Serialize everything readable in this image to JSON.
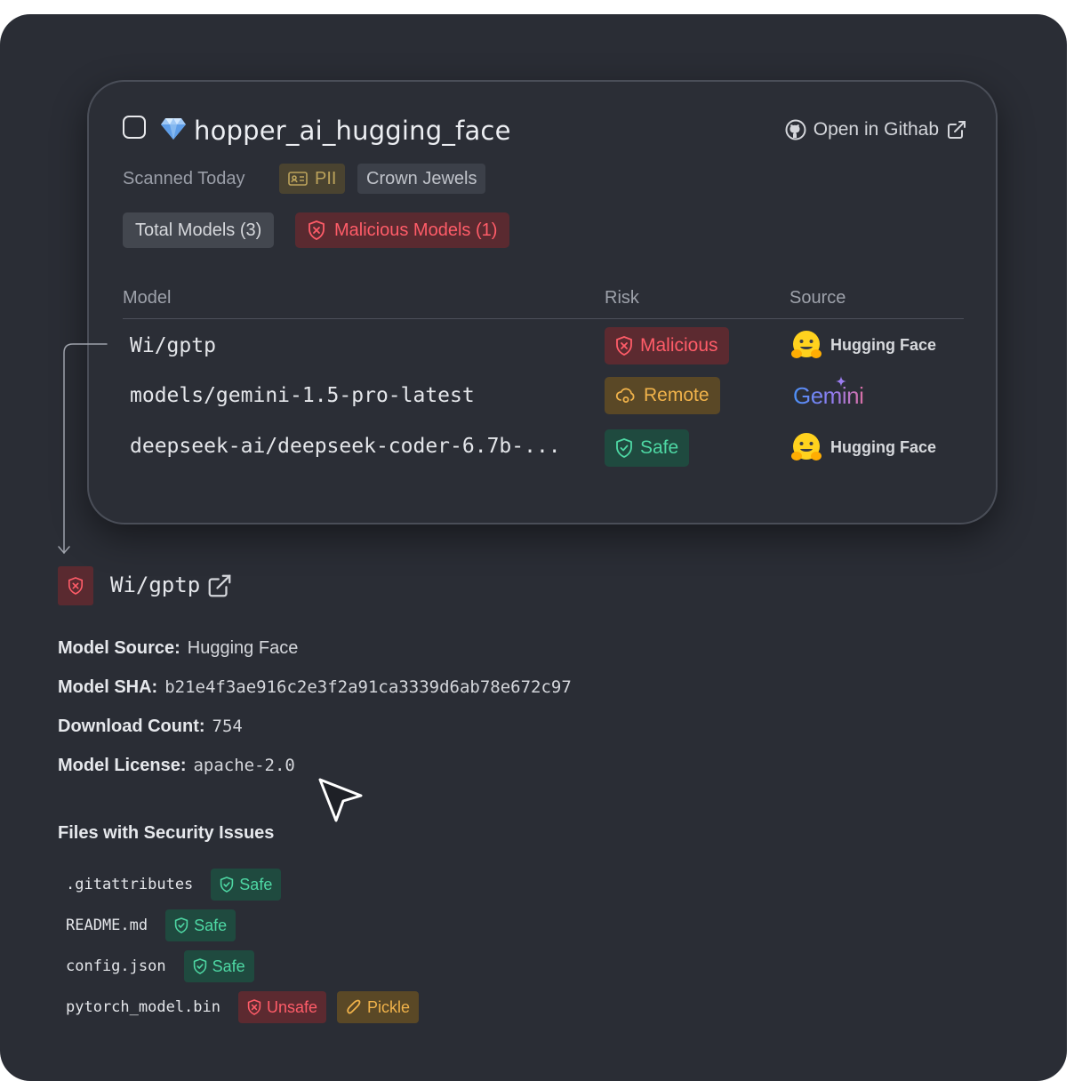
{
  "repo": {
    "name": "hopper_ai_hugging_face",
    "open_link": "Open in Githab",
    "scanned": "Scanned Today",
    "tags": {
      "pii": "PII",
      "crown": "Crown Jewels"
    },
    "total_models": "Total Models (3)",
    "malicious_models": "Malicious Models (1)"
  },
  "table": {
    "headers": {
      "model": "Model",
      "risk": "Risk",
      "source": "Source"
    },
    "rows": [
      {
        "model": "Wi/gptp",
        "risk": "Malicious",
        "source": "Hugging Face"
      },
      {
        "model": "models/gemini-1.5-pro-latest",
        "risk": "Remote",
        "source": "Gemini"
      },
      {
        "model": "deepseek-ai/deepseek-coder-6.7b-...",
        "risk": "Safe",
        "source": "Hugging Face"
      }
    ]
  },
  "detail": {
    "title": "Wi/gptp",
    "props": {
      "source_k": "Model Source:",
      "source_v": "Hugging Face",
      "sha_k": "Model SHA:",
      "sha_v": "b21e4f3ae916c2e3f2a91ca3339d6ab78e672c97",
      "count_k": "Download Count:",
      "count_v": "754",
      "license_k": "Model License:",
      "license_v": "apache-2.0"
    },
    "files_title": "Files with Security Issues",
    "files": [
      {
        "name": ".gitattributes",
        "status": "Safe"
      },
      {
        "name": "README.md",
        "status": "Safe"
      },
      {
        "name": "config.json",
        "status": "Safe"
      },
      {
        "name": "pytorch_model.bin",
        "status": "Unsafe",
        "extra": "Pickle"
      }
    ]
  },
  "colors": {
    "background": "#2a2d35",
    "malicious": "#ff5c68",
    "remote": "#f0b24a",
    "safe": "#4ed8a4"
  },
  "icons": [
    "checkbox",
    "gem-icon",
    "github-icon",
    "external-link-icon",
    "id-card-icon",
    "shield-x-icon",
    "cloud-icon",
    "shield-check-icon",
    "hugging-face-icon",
    "pickle-icon",
    "cursor-icon"
  ]
}
